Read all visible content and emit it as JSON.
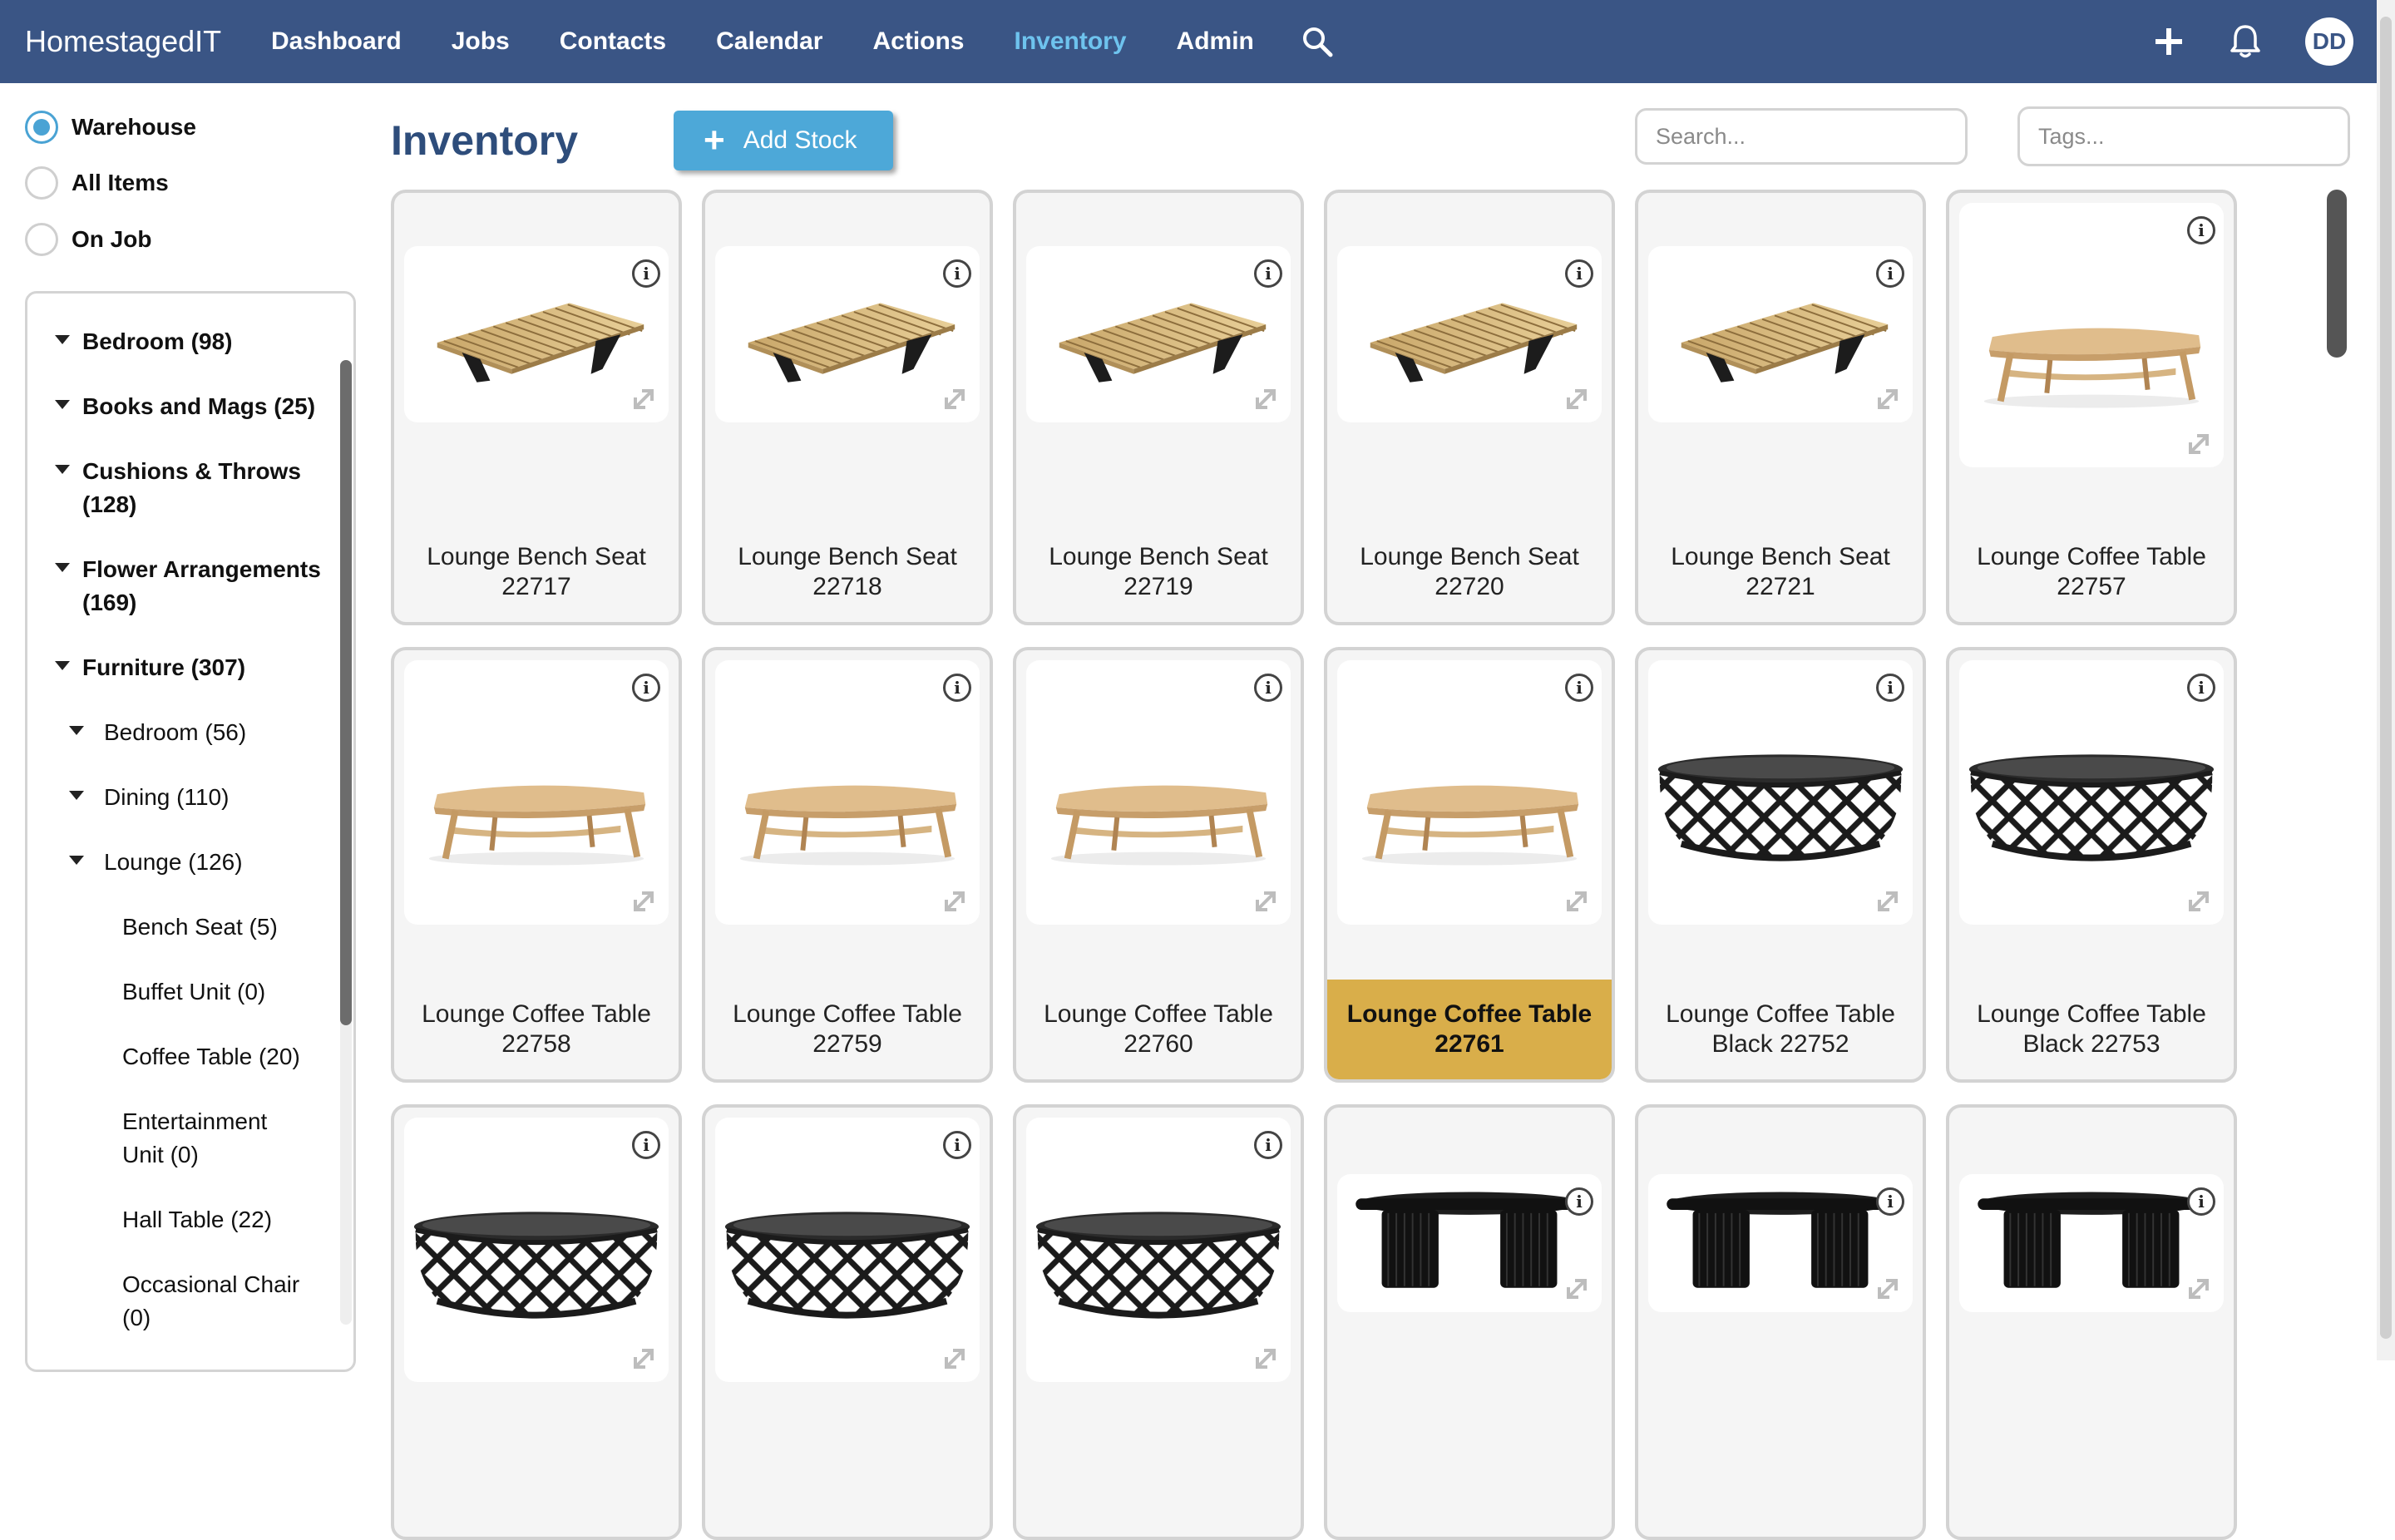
{
  "nav": {
    "brand": "HomestagedIT",
    "links": [
      "Dashboard",
      "Jobs",
      "Contacts",
      "Calendar",
      "Actions",
      "Inventory",
      "Admin"
    ],
    "active": "Inventory",
    "avatar_initials": "DD",
    "icons": [
      "search-icon",
      "plus-icon",
      "bell-icon"
    ]
  },
  "filters": {
    "options": [
      "Warehouse",
      "All Items",
      "On Job"
    ],
    "selected": "Warehouse"
  },
  "tree": {
    "items": [
      {
        "label": "Bedroom (98)",
        "level": 0
      },
      {
        "label": "Books and Mags (25)",
        "level": 0
      },
      {
        "label": "Cushions & Throws (128)",
        "level": 0
      },
      {
        "label": "Flower Arrangements (169)",
        "level": 0
      },
      {
        "label": "Furniture (307)",
        "level": 0
      },
      {
        "label": "Bedroom (56)",
        "level": 1
      },
      {
        "label": "Dining (110)",
        "level": 1
      },
      {
        "label": "Lounge (126)",
        "level": 1
      },
      {
        "label": "Bench Seat (5)",
        "level": 2
      },
      {
        "label": "Buffet Unit (0)",
        "level": 2
      },
      {
        "label": "Coffee Table (20)",
        "level": 2
      },
      {
        "label": "Entertainment Unit (0)",
        "level": 2
      },
      {
        "label": "Hall Table (22)",
        "level": 2
      },
      {
        "label": "Occasional Chair (0)",
        "level": 2
      }
    ]
  },
  "main": {
    "title": "Inventory",
    "add_button": "Add Stock",
    "search_placeholder": "Search...",
    "tags_placeholder": "Tags..."
  },
  "cards": [
    {
      "label": "Lounge Bench Seat 22717",
      "image": "bench",
      "selected": false
    },
    {
      "label": "Lounge Bench Seat 22718",
      "image": "bench",
      "selected": false
    },
    {
      "label": "Lounge Bench Seat 22719",
      "image": "bench",
      "selected": false
    },
    {
      "label": "Lounge Bench Seat 22720",
      "image": "bench",
      "selected": false
    },
    {
      "label": "Lounge Bench Seat 22721",
      "image": "bench",
      "selected": false
    },
    {
      "label": "Lounge Coffee Table 22757",
      "image": "wood-table",
      "selected": false
    },
    {
      "label": "Lounge Coffee Table 22758",
      "image": "wood-table",
      "selected": false
    },
    {
      "label": "Lounge Coffee Table 22759",
      "image": "wood-table",
      "selected": false
    },
    {
      "label": "Lounge Coffee Table 22760",
      "image": "wood-table",
      "selected": false
    },
    {
      "label": "Lounge Coffee Table 22761",
      "image": "wood-table",
      "selected": true
    },
    {
      "label": "Lounge Coffee Table Black 22752",
      "image": "black-drum-table",
      "selected": false
    },
    {
      "label": "Lounge Coffee Table Black 22753",
      "image": "black-drum-table",
      "selected": false
    },
    {
      "label": "",
      "image": "black-drum-table",
      "selected": false
    },
    {
      "label": "",
      "image": "black-drum-table",
      "selected": false
    },
    {
      "label": "",
      "image": "black-drum-table",
      "selected": false
    },
    {
      "label": "",
      "image": "black-pedestal-table",
      "selected": false
    },
    {
      "label": "",
      "image": "black-pedestal-table",
      "selected": false
    },
    {
      "label": "",
      "image": "black-pedestal-table",
      "selected": false
    }
  ],
  "colors": {
    "navbar": "#3a5585",
    "active_link": "#6ec3ee",
    "accent_button": "#4da8d8",
    "selected_card": "#d9ae4a",
    "title": "#2e4d7b"
  }
}
